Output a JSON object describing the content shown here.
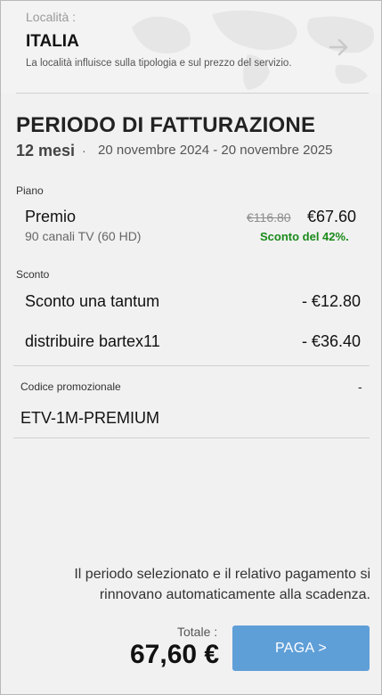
{
  "location": {
    "label": "Località :",
    "country": "ITALIA",
    "note": "La località influisce sulla tipologia e sul prezzo del servizio."
  },
  "billing": {
    "title": "PERIODO DI FATTURAZIONE",
    "months": "12 mesi",
    "separator": "·",
    "dates": "20 novembre 2024 - 20 novembre 2025"
  },
  "plan": {
    "section_label": "Piano",
    "name": "Premio",
    "description": "90 canali TV (60 HD)",
    "old_price": "€116.80",
    "new_price": "€67.60",
    "discount_text": "Sconto del 42%."
  },
  "discounts": {
    "section_label": "Sconto",
    "items": [
      {
        "name": "Sconto una tantum",
        "value": "- €12.80"
      },
      {
        "name": "distribuire bartex11",
        "value": "- €36.40"
      }
    ]
  },
  "promo": {
    "label": "Codice promozionale",
    "value": "-",
    "code": "ETV-1M-PREMIUM"
  },
  "footer": {
    "renew_note": "Il periodo selezionato e il relativo pagamento si rinnovano automaticamente alla scadenza.",
    "total_label": "Totale :",
    "total_value": "67,60 €",
    "pay_label": "PAGA >"
  },
  "colors": {
    "accent": "#5f9fd8",
    "discount_green": "#1a8a1a",
    "background": "#f1f1f1"
  }
}
